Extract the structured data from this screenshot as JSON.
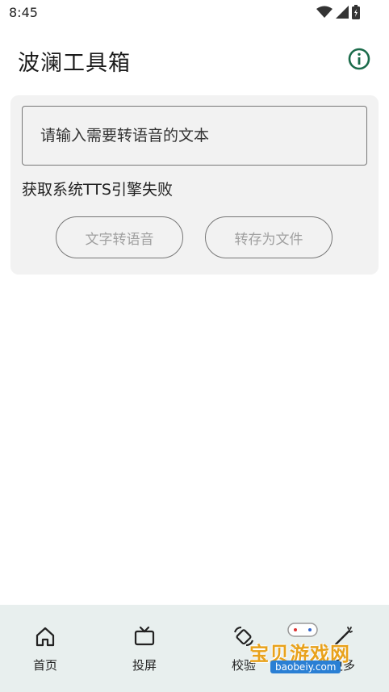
{
  "status_bar": {
    "time": "8:45"
  },
  "app_bar": {
    "title": "波澜工具箱"
  },
  "card": {
    "input_placeholder": "请输入需要转语音的文本",
    "status_message": "获取系统TTS引擎失败",
    "tts_button_label": "文字转语音",
    "save_button_label": "转存为文件"
  },
  "bottom_nav": {
    "items": [
      {
        "label": "首页",
        "icon": "home-icon"
      },
      {
        "label": "投屏",
        "icon": "tv-icon"
      },
      {
        "label": "校验",
        "icon": "rotate-icon"
      },
      {
        "label": "更多",
        "icon": "magic-wand-icon"
      }
    ]
  },
  "watermark": {
    "title": "宝贝游戏网",
    "url": "baobeiy.com"
  },
  "colors": {
    "accent": "#1a6b4a",
    "nav_bg": "#e8efee",
    "card_bg": "#f2f2f2"
  }
}
